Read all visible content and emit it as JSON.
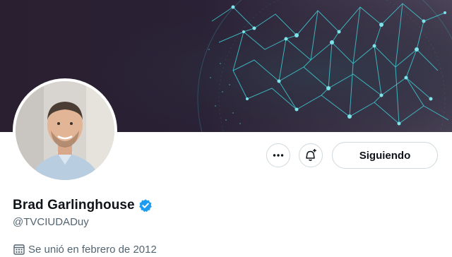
{
  "profile": {
    "name": "Brad Garlinghouse",
    "handle": "@TVCIUDADuy",
    "joined": "Se unió en febrero de 2012"
  },
  "actions": {
    "follow_label": "Siguiendo"
  },
  "icons": {
    "more": "more-horizontal-icon",
    "notify": "bell-plus-icon",
    "verified": "verified-badge-icon",
    "calendar": "calendar-icon"
  },
  "colors": {
    "verified": "#1d9bf0",
    "banner_network": "#3fc9d2",
    "secondary_text": "#536471"
  }
}
